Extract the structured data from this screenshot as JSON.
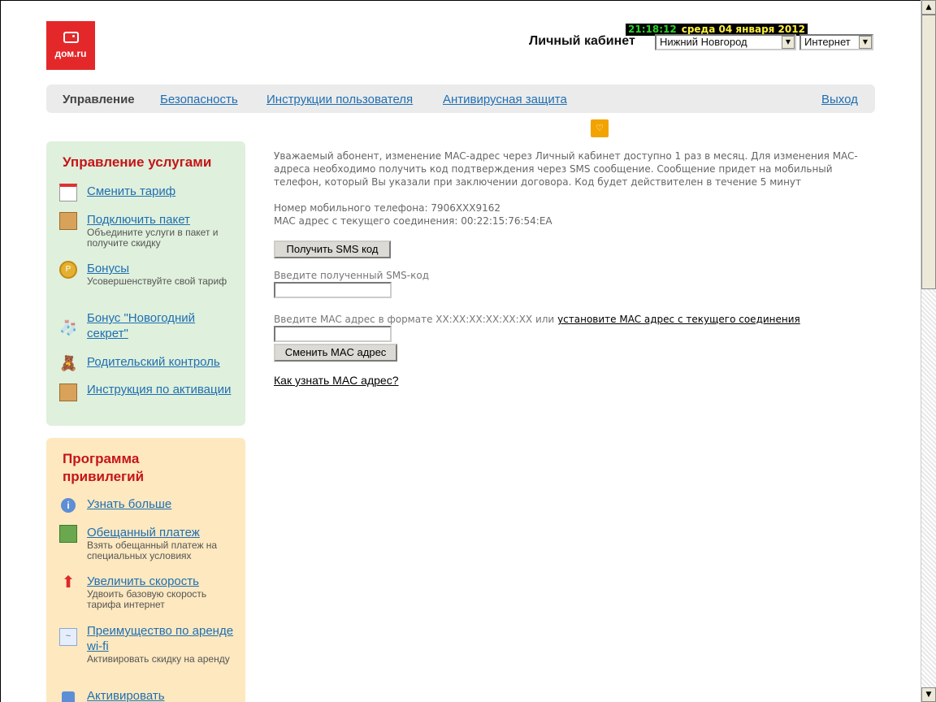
{
  "header": {
    "logo_text": "дом.ru",
    "clock_time": "21:18:12",
    "clock_date": "среда 04 января 2012",
    "cabinet_title": "Личный кабинет",
    "city_select": "Нижний Новгород",
    "service_select": "Интернет"
  },
  "nav": {
    "items": [
      "Управление",
      "Безопасность",
      "Инструкции пользователя",
      "Антивирусная защита"
    ],
    "logout": "Выход"
  },
  "services_panel": {
    "title": "Управление услугами",
    "items": [
      {
        "label": "Сменить тариф",
        "desc": ""
      },
      {
        "label": "Подключить пакет",
        "desc": "Объедините услуги в пакет и получите скидку"
      },
      {
        "label": "Бонусы",
        "desc": "Усовершенствуйте свой тариф"
      },
      {
        "label": "Бонус \"Новогодний секрет\"",
        "desc": ""
      },
      {
        "label": "Родительский контроль",
        "desc": ""
      },
      {
        "label": "Инструкция по активации",
        "desc": ""
      }
    ]
  },
  "privileges_panel": {
    "title": "Программа привилегий",
    "items": [
      {
        "label": "Узнать больше",
        "desc": ""
      },
      {
        "label": "Обещанный платеж",
        "desc": "Взять обещанный платеж на специальных условиях"
      },
      {
        "label": "Увеличить скорость",
        "desc": "Удвоить базовую скорость тарифа интернет"
      },
      {
        "label": "Преимущество по аренде wi-fi",
        "desc": "Активировать скидку на аренду"
      },
      {
        "label": "Активировать",
        "desc": ""
      }
    ]
  },
  "main": {
    "intro": "Уважаемый абонент, изменение MAC-адрес через Личный кабинет доступно 1 раз в месяц. Для изменения MAC-адреса необходимо получить код подтверждения через SMS сообщение. Сообщение придет на мобильный телефон, который Вы указали при заключении договора. Код будет действителен в течение 5 минут",
    "phone_line": "Номер мобильного телефона: 7906XXX9162",
    "mac_line": "MAC адрес с текущего соединения: 00:22:15:76:54:EA",
    "get_sms_button": "Получить SMS код",
    "sms_label": "Введите полученный SMS-код",
    "sms_value": "",
    "mac_label": "Введите MAC адрес в формате XX:XX:XX:XX:XX:XX или",
    "mac_link": "установите MAC адрес с текущего соединения",
    "mac_value": "",
    "change_mac_button": "Сменить MAC адрес",
    "howto_link": "Как узнать MAC адрес?"
  },
  "colors": {
    "brand_red": "#e4282a",
    "link_blue": "#1f6fb3",
    "panel_green": "#dff0dc",
    "panel_yellow": "#fde8bf",
    "title_red": "#c41518"
  },
  "icons": [
    "calendar-icon",
    "box-icon",
    "coin-icon",
    "sock-icon",
    "bear-icon",
    "info-icon",
    "promise-payment-icon",
    "up-arrow-icon",
    "chart-icon",
    "shield-icon",
    "gift-icon"
  ]
}
